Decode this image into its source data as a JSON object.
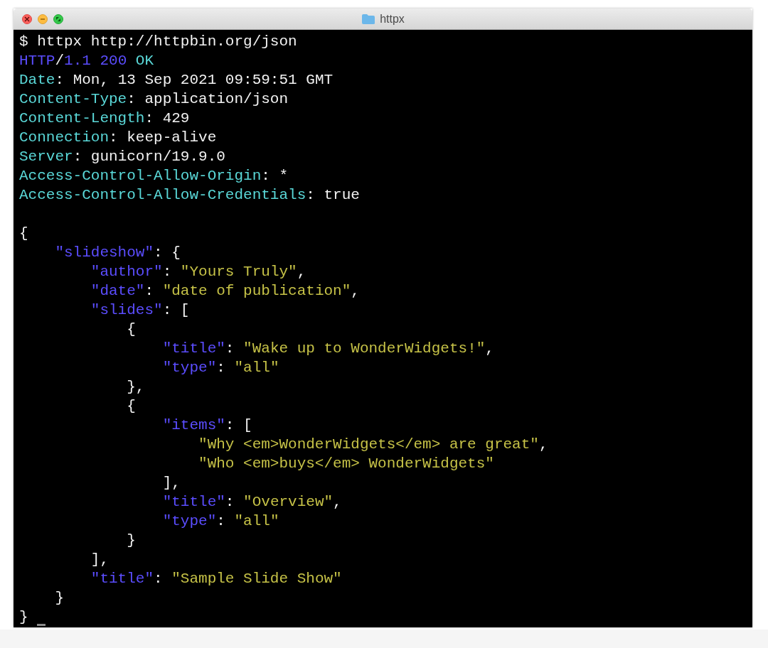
{
  "window": {
    "title": "httpx"
  },
  "lines": [
    {
      "segments": [
        {
          "kind": "plain",
          "text": "$ httpx http://httpbin.org/json"
        }
      ]
    },
    {
      "segments": [
        {
          "kind": "number",
          "text": "HTTP"
        },
        {
          "kind": "plain",
          "text": "/"
        },
        {
          "kind": "number",
          "text": "1.1 200 "
        },
        {
          "kind": "header",
          "text": "OK"
        }
      ]
    },
    {
      "segments": [
        {
          "kind": "header",
          "text": "Date"
        },
        {
          "kind": "plain",
          "text": ": Mon, 13 Sep 2021 09:59:51 GMT"
        }
      ]
    },
    {
      "segments": [
        {
          "kind": "header",
          "text": "Content-Type"
        },
        {
          "kind": "plain",
          "text": ": application/json"
        }
      ]
    },
    {
      "segments": [
        {
          "kind": "header",
          "text": "Content-Length"
        },
        {
          "kind": "plain",
          "text": ": 429"
        }
      ]
    },
    {
      "segments": [
        {
          "kind": "header",
          "text": "Connection"
        },
        {
          "kind": "plain",
          "text": ": keep-alive"
        }
      ]
    },
    {
      "segments": [
        {
          "kind": "header",
          "text": "Server"
        },
        {
          "kind": "plain",
          "text": ": gunicorn/19.9.0"
        }
      ]
    },
    {
      "segments": [
        {
          "kind": "header",
          "text": "Access-Control-Allow-Origin"
        },
        {
          "kind": "plain",
          "text": ": *"
        }
      ]
    },
    {
      "segments": [
        {
          "kind": "header",
          "text": "Access-Control-Allow-Credentials"
        },
        {
          "kind": "plain",
          "text": ": true"
        }
      ]
    },
    {
      "kind": "blank"
    },
    {
      "segments": [
        {
          "kind": "plain",
          "text": "{"
        }
      ]
    },
    {
      "segments": [
        {
          "kind": "key",
          "text": "    \"slideshow\""
        },
        {
          "kind": "plain",
          "text": ": {"
        }
      ]
    },
    {
      "segments": [
        {
          "kind": "key",
          "text": "        \"author\""
        },
        {
          "kind": "plain",
          "text": ": "
        },
        {
          "kind": "string",
          "text": "\"Yours Truly\""
        },
        {
          "kind": "plain",
          "text": ","
        }
      ]
    },
    {
      "segments": [
        {
          "kind": "key",
          "text": "        \"date\""
        },
        {
          "kind": "plain",
          "text": ": "
        },
        {
          "kind": "string",
          "text": "\"date of publication\""
        },
        {
          "kind": "plain",
          "text": ","
        }
      ]
    },
    {
      "segments": [
        {
          "kind": "key",
          "text": "        \"slides\""
        },
        {
          "kind": "plain",
          "text": ": ["
        }
      ]
    },
    {
      "segments": [
        {
          "kind": "plain",
          "text": "            {"
        }
      ]
    },
    {
      "segments": [
        {
          "kind": "key",
          "text": "                \"title\""
        },
        {
          "kind": "plain",
          "text": ": "
        },
        {
          "kind": "string",
          "text": "\"Wake up to WonderWidgets!\""
        },
        {
          "kind": "plain",
          "text": ","
        }
      ]
    },
    {
      "segments": [
        {
          "kind": "key",
          "text": "                \"type\""
        },
        {
          "kind": "plain",
          "text": ": "
        },
        {
          "kind": "string",
          "text": "\"all\""
        }
      ]
    },
    {
      "segments": [
        {
          "kind": "plain",
          "text": "            },"
        }
      ]
    },
    {
      "segments": [
        {
          "kind": "plain",
          "text": "            {"
        }
      ]
    },
    {
      "segments": [
        {
          "kind": "key",
          "text": "                \"items\""
        },
        {
          "kind": "plain",
          "text": ": ["
        }
      ]
    },
    {
      "segments": [
        {
          "kind": "string",
          "text": "                    \"Why <em>WonderWidgets</em> are great\""
        },
        {
          "kind": "plain",
          "text": ","
        }
      ]
    },
    {
      "segments": [
        {
          "kind": "string",
          "text": "                    \"Who <em>buys</em> WonderWidgets\""
        }
      ]
    },
    {
      "segments": [
        {
          "kind": "plain",
          "text": "                ],"
        }
      ]
    },
    {
      "segments": [
        {
          "kind": "key",
          "text": "                \"title\""
        },
        {
          "kind": "plain",
          "text": ": "
        },
        {
          "kind": "string",
          "text": "\"Overview\""
        },
        {
          "kind": "plain",
          "text": ","
        }
      ]
    },
    {
      "segments": [
        {
          "kind": "key",
          "text": "                \"type\""
        },
        {
          "kind": "plain",
          "text": ": "
        },
        {
          "kind": "string",
          "text": "\"all\""
        }
      ]
    },
    {
      "segments": [
        {
          "kind": "plain",
          "text": "            }"
        }
      ]
    },
    {
      "segments": [
        {
          "kind": "plain",
          "text": "        ],"
        }
      ]
    },
    {
      "segments": [
        {
          "kind": "key",
          "text": "        \"title\""
        },
        {
          "kind": "plain",
          "text": ": "
        },
        {
          "kind": "string",
          "text": "\"Sample Slide Show\""
        }
      ]
    },
    {
      "segments": [
        {
          "kind": "plain",
          "text": "    }"
        }
      ]
    },
    {
      "segments": [
        {
          "kind": "plain",
          "text": "}"
        }
      ]
    }
  ]
}
